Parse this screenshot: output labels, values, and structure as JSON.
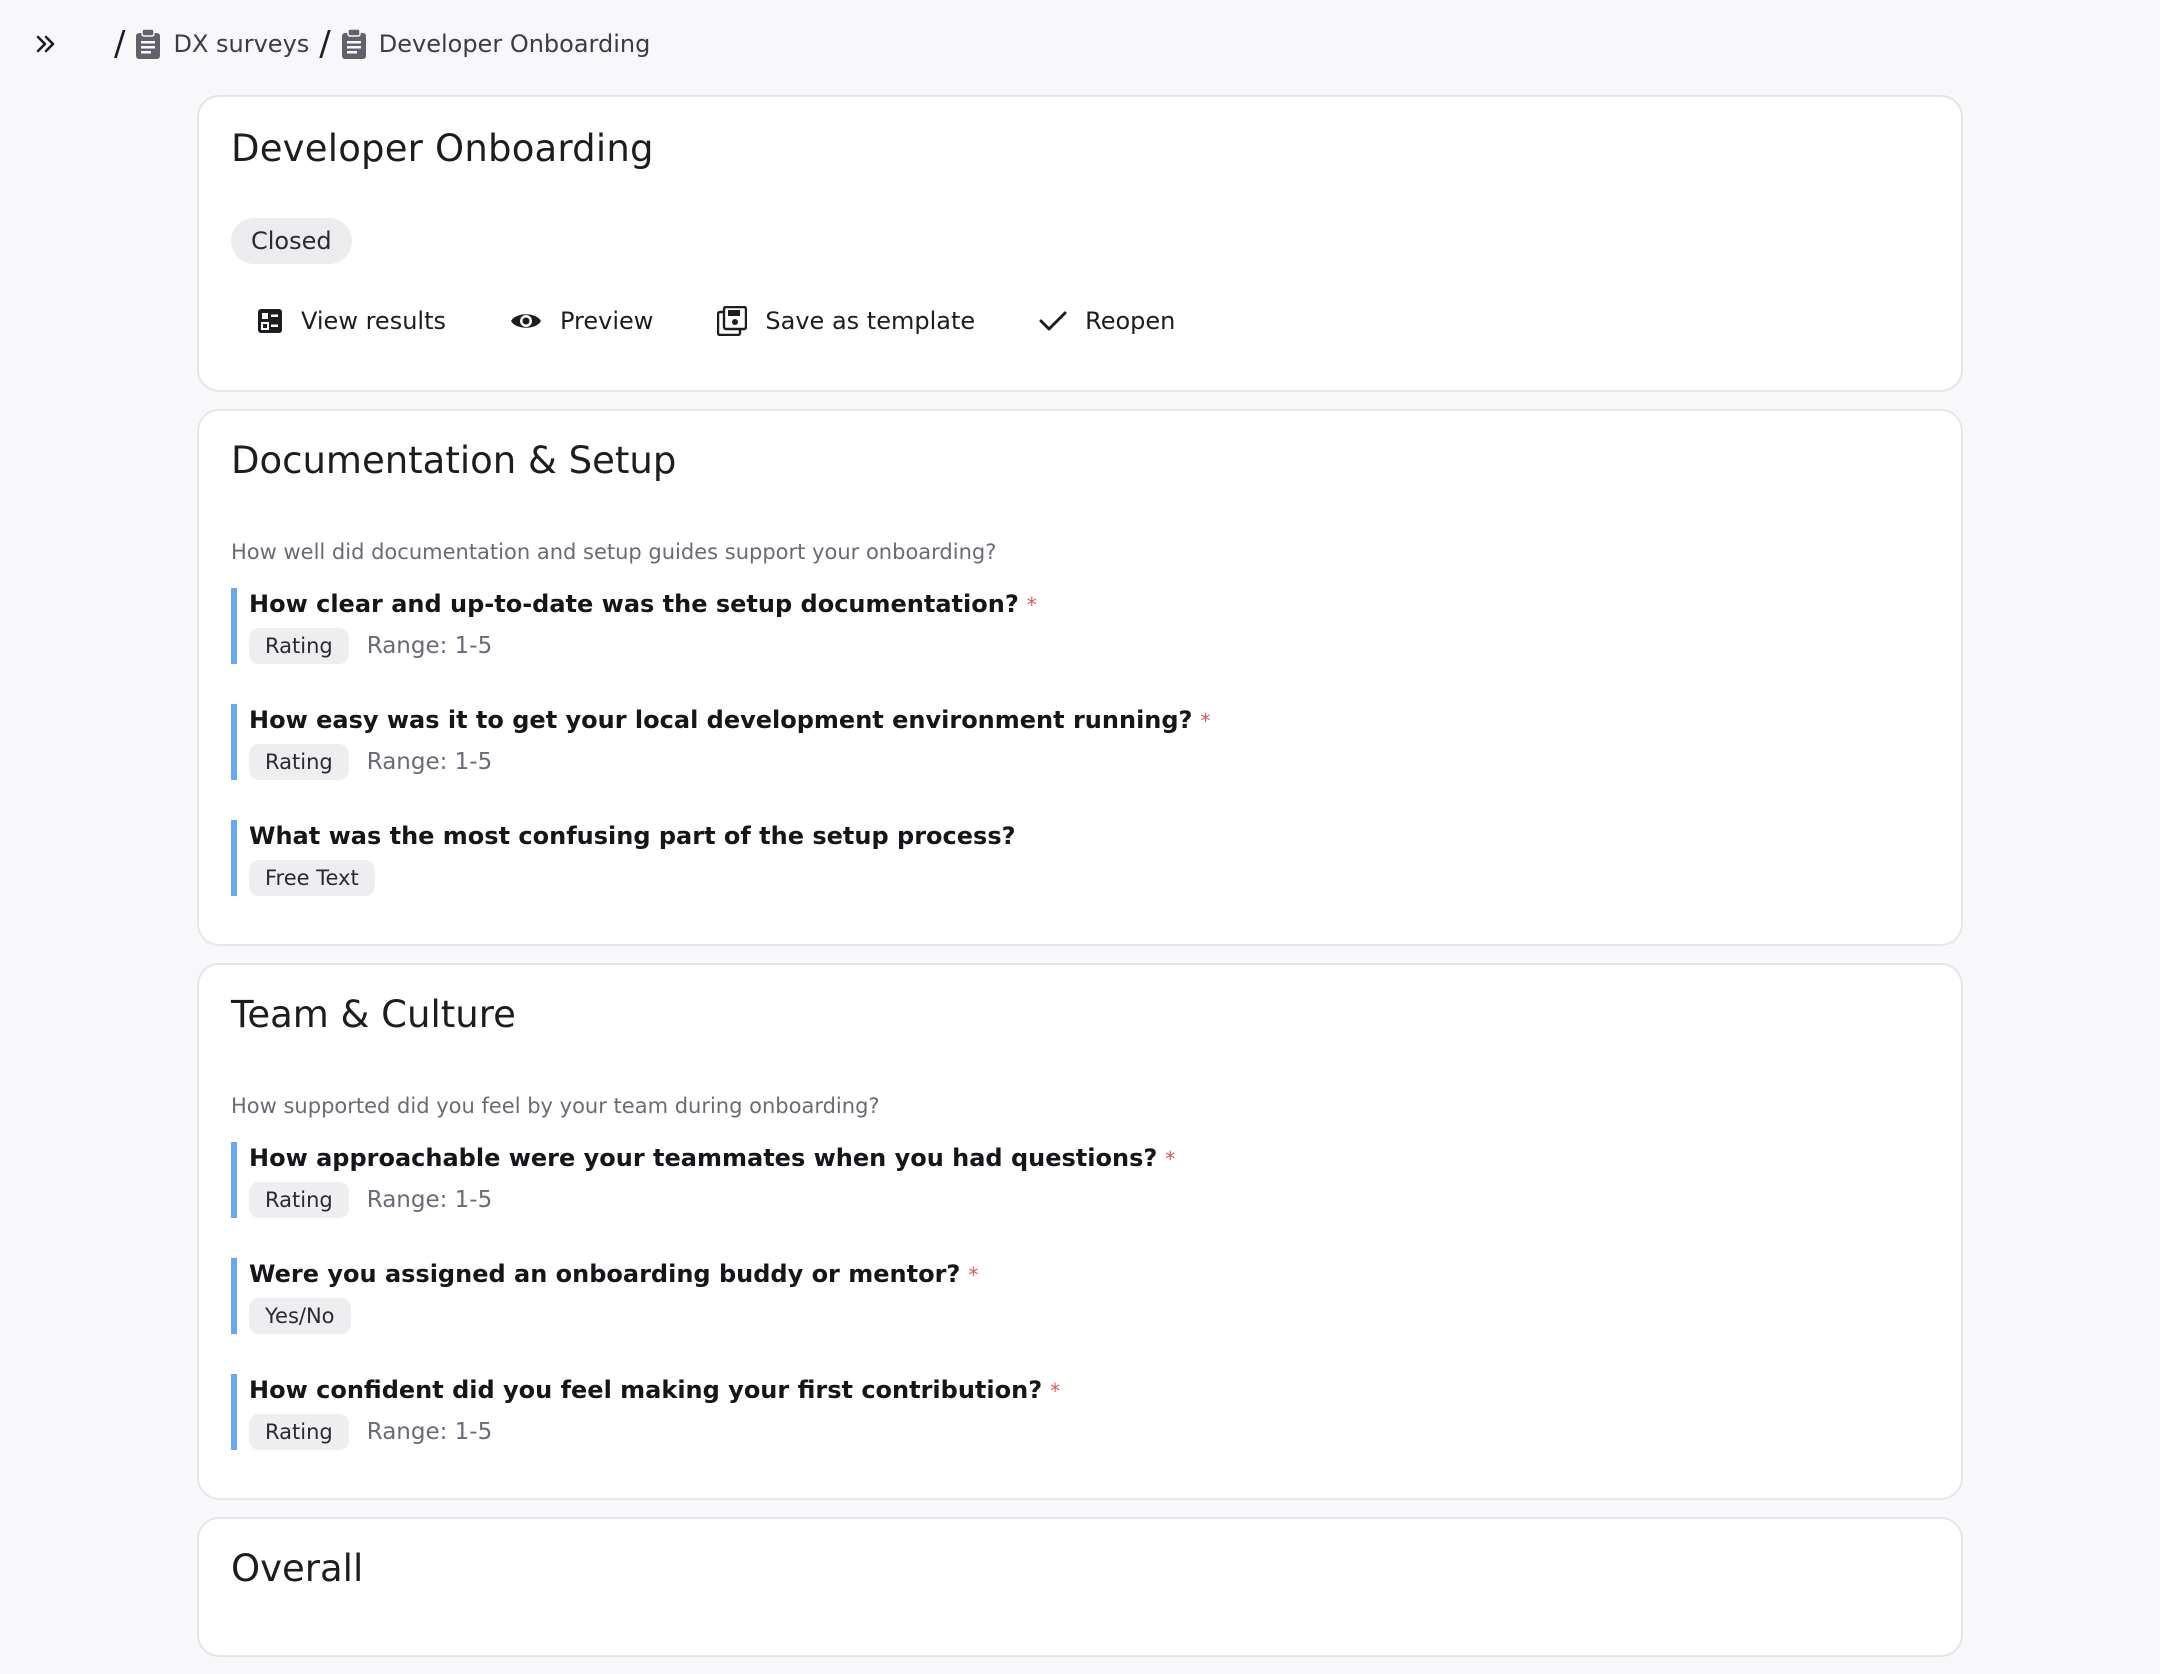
{
  "breadcrumbs": [
    {
      "label": "DX surveys"
    },
    {
      "label": "Developer Onboarding"
    }
  ],
  "breadcrumb_separator": "/",
  "survey": {
    "title": "Developer Onboarding",
    "status": "Closed",
    "actions": [
      {
        "label": "View results",
        "icon": "results-icon"
      },
      {
        "label": "Preview",
        "icon": "eye-icon"
      },
      {
        "label": "Save as template",
        "icon": "save-template-icon"
      },
      {
        "label": "Reopen",
        "icon": "check-icon"
      }
    ]
  },
  "required_marker": "*",
  "sections": [
    {
      "title": "Documentation & Setup",
      "description": "How well did documentation and setup guides support your onboarding?",
      "questions": [
        {
          "text": "How clear and up-to-date was the setup documentation?",
          "required": true,
          "type": "Rating",
          "range": "Range: 1-5"
        },
        {
          "text": "How easy was it to get your local development environment running?",
          "required": true,
          "type": "Rating",
          "range": "Range: 1-5"
        },
        {
          "text": "What was the most confusing part of the setup process?",
          "required": false,
          "type": "Free Text",
          "range": ""
        }
      ]
    },
    {
      "title": "Team & Culture",
      "description": "How supported did you feel by your team during onboarding?",
      "questions": [
        {
          "text": "How approachable were your teammates when you had questions?",
          "required": true,
          "type": "Rating",
          "range": "Range: 1-5"
        },
        {
          "text": "Were you assigned an onboarding buddy or mentor?",
          "required": true,
          "type": "Yes/No",
          "range": ""
        },
        {
          "text": "How confident did you feel making your first contribution?",
          "required": true,
          "type": "Rating",
          "range": "Range: 1-5"
        }
      ]
    },
    {
      "title": "Overall"
    }
  ],
  "colors": {
    "accent": "#6aa8ec",
    "required": "#e05656",
    "background": "#f8f8fa"
  }
}
